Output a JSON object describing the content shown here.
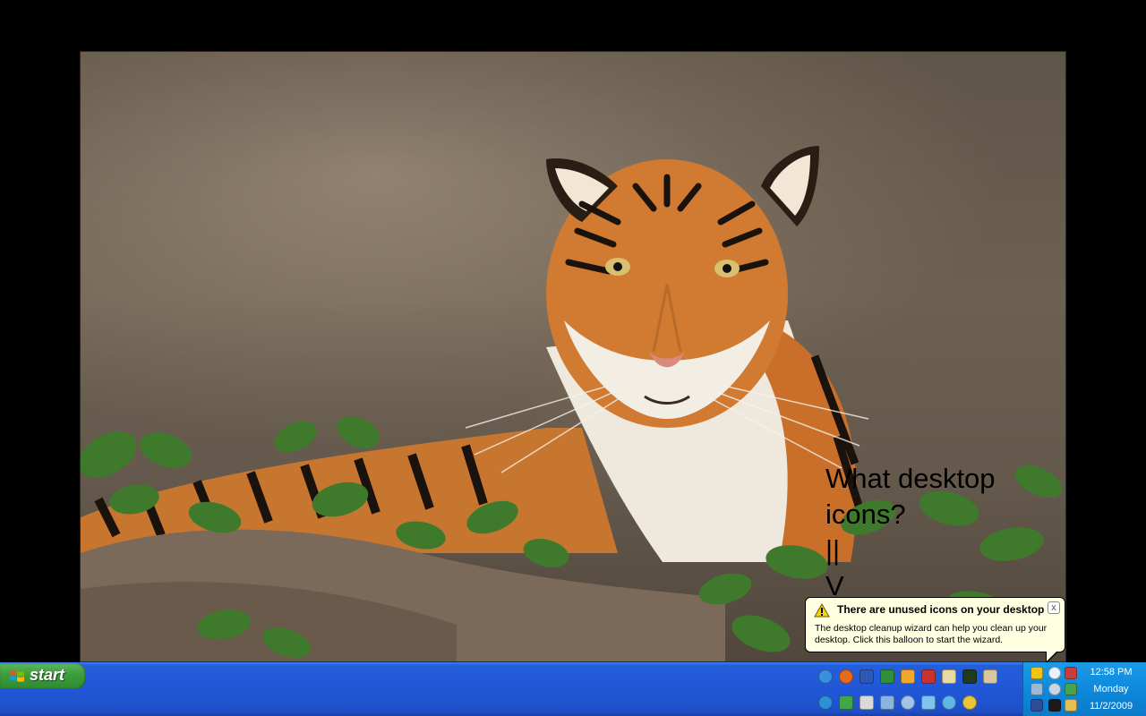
{
  "desktop": {
    "annotation": "What desktop\nicons?\n||\nV"
  },
  "balloon": {
    "title": "There are unused icons on your desktop",
    "body": "The desktop cleanup wizard can help you clean up your desktop. Click this balloon to start the wizard.",
    "close_label": "x"
  },
  "taskbar": {
    "start_label": "start"
  },
  "clock": {
    "time": "12:58 PM",
    "day": "Monday",
    "date": "11/2/2009"
  },
  "colors": {
    "taskbar_blue": "#245edb",
    "tray_blue": "#0f89dc",
    "start_green": "#3c9d3c",
    "balloon_bg": "#ffffe1"
  }
}
